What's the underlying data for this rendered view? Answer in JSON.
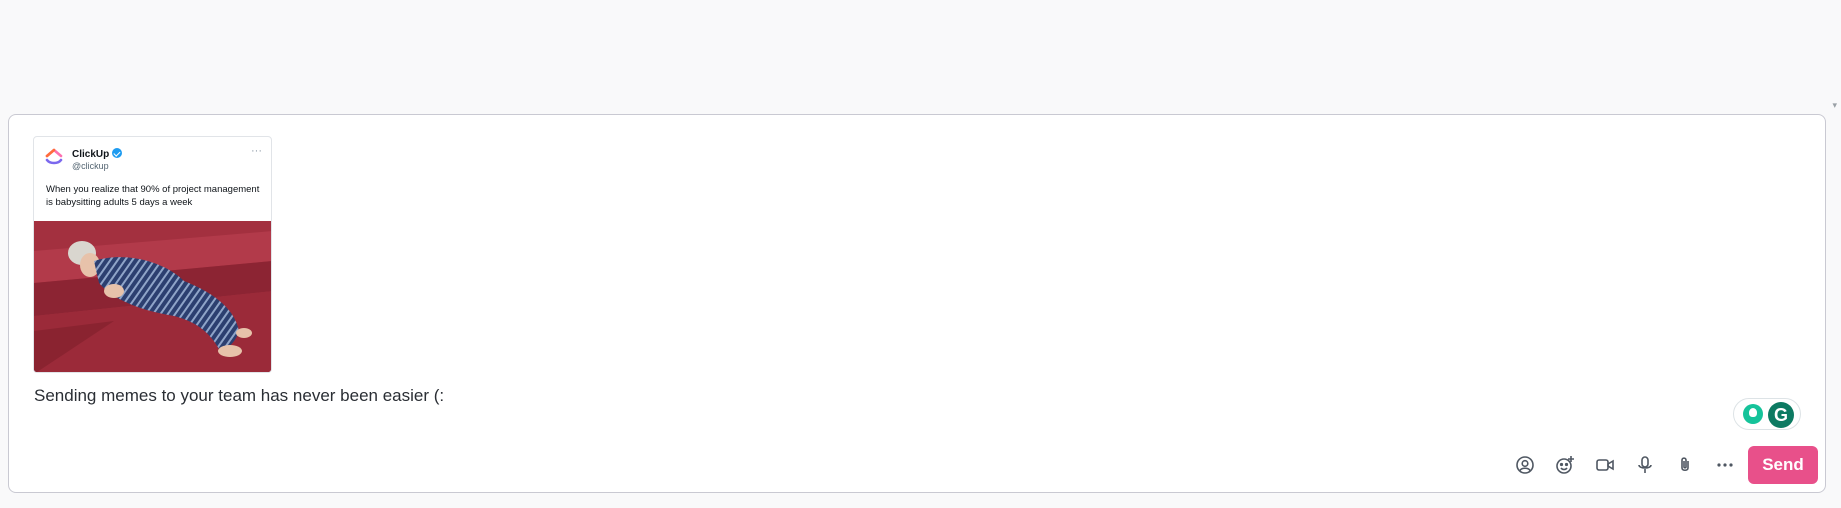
{
  "tweet": {
    "name": "ClickUp",
    "handle": "@clickup",
    "more_icon": "···",
    "text": "When you realize that 90% of project management is babysitting adults 5 days a week"
  },
  "composer": {
    "message": "Sending memes to your team has never been easier (:"
  },
  "toolbar": {
    "icons": [
      "mention-icon",
      "emoji-add-icon",
      "video-icon",
      "microphone-icon",
      "paperclip-icon",
      "more-icon"
    ],
    "send_label": "Send"
  },
  "grammarly": {
    "logo_letter": "G"
  },
  "colors": {
    "send": "#e8508a",
    "grammarly_green": "#15c39a",
    "grammarly_dark": "#0d7a62",
    "image_bg": "#9a2838"
  }
}
